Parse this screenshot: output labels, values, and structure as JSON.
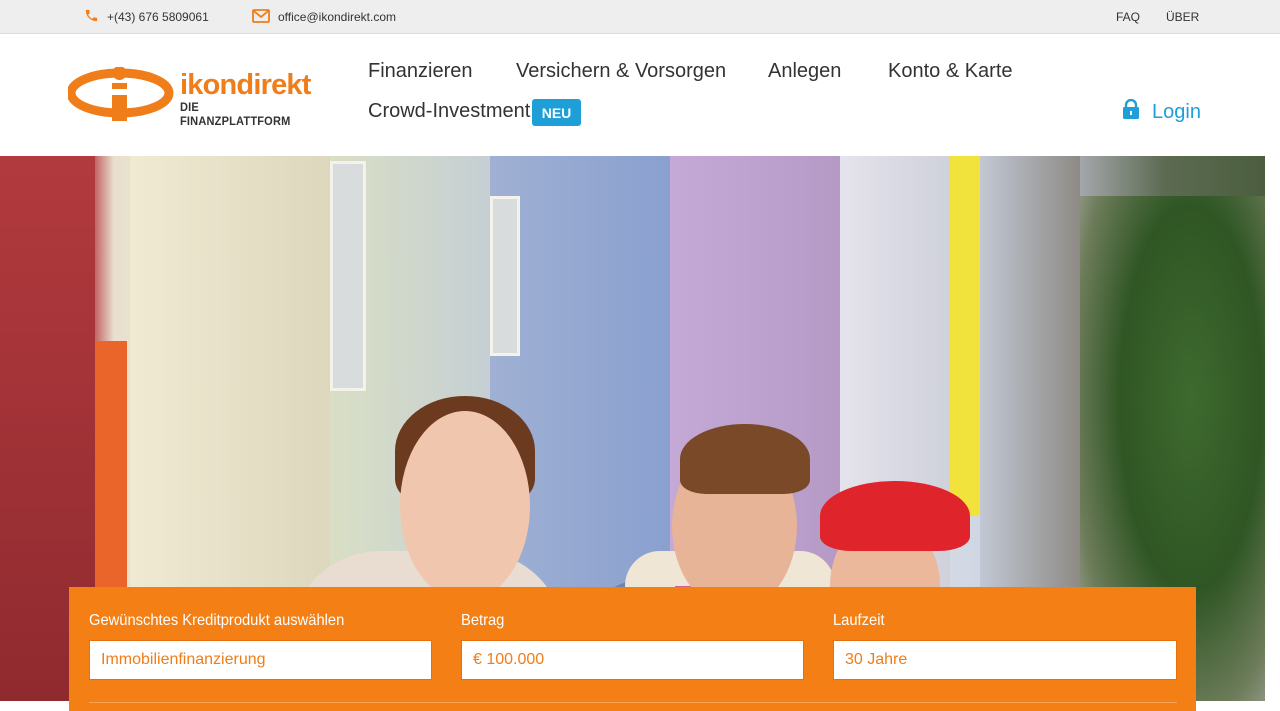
{
  "topbar": {
    "phone": "+(43) 676 5809061",
    "email": "office@ikondirekt.com",
    "links": {
      "faq": "FAQ",
      "ueber": "ÜBER"
    }
  },
  "header": {
    "logo": {
      "brand": "ikondirekt",
      "tagline": "DIE FINANZPLATTFORM"
    },
    "nav": {
      "finanzieren": "Finanzieren",
      "versichern": "Versichern & Vorsorgen",
      "anlegen": "Anlegen",
      "konto": "Konto & Karte",
      "crowd": "Crowd-Investment",
      "crowd_badge": "NEU"
    },
    "login": "Login"
  },
  "form": {
    "product": {
      "label": "Gewünschtes Kreditprodukt auswählen",
      "value": "Immobilienfinanzierung"
    },
    "amount": {
      "label": "Betrag",
      "value": "€ 100.000"
    },
    "term": {
      "label": "Laufzeit",
      "value": "30 Jahre"
    }
  },
  "colors": {
    "brand_orange": "#f47f15",
    "link_blue": "#1e9fd8",
    "topbar_bg": "#eeeeee"
  },
  "icons": {
    "phone": "phone-icon",
    "mail": "mail-icon",
    "login": "lock-icon"
  }
}
